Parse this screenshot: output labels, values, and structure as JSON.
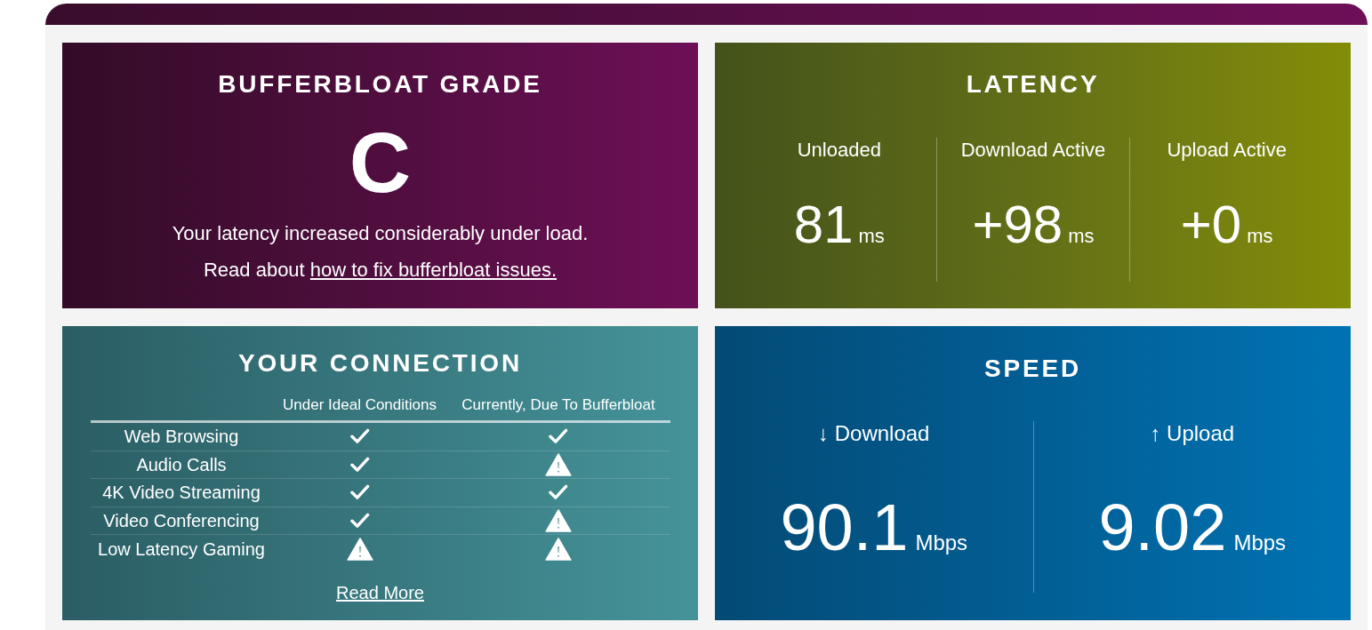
{
  "grade_panel": {
    "title": "BUFFERBLOAT GRADE",
    "grade": "C",
    "summary": "Your latency increased considerably under load.",
    "fix_note": {
      "text": "Read about",
      "link": "how to fix bufferbloat issues."
    }
  },
  "latency_panel": {
    "title": "LATENCY",
    "metrics": [
      {
        "label": "Unloaded",
        "value": "81",
        "unit": "ms"
      },
      {
        "label": "Download Active",
        "value": "+98",
        "unit": "ms"
      },
      {
        "label": "Upload Active",
        "value": "+0",
        "unit": "ms"
      }
    ]
  },
  "connection_panel": {
    "title": "YOUR CONNECTION",
    "columns": [
      "Under Ideal Conditions",
      "Currently, Due To Bufferbloat"
    ],
    "rows": [
      {
        "activity": "Web Browsing",
        "ideal_warning": false,
        "current_warning": false
      },
      {
        "activity": "Audio Calls",
        "ideal_warning": false,
        "current_warning": true
      },
      {
        "activity": "4K Video Streaming",
        "ideal_warning": false,
        "current_warning": false
      },
      {
        "activity": "Video Conferencing",
        "ideal_warning": false,
        "current_warning": true
      },
      {
        "activity": "Low Latency Gaming",
        "ideal_warning": true,
        "current_warning": true
      }
    ],
    "read_more": "Read More"
  },
  "speed_panel": {
    "title": "SPEED",
    "metrics": [
      {
        "label": "↓ Download",
        "value": "90.1",
        "unit": "Mbps"
      },
      {
        "label": "↑ Upload",
        "value": "9.02",
        "unit": "Mbps"
      }
    ]
  }
}
